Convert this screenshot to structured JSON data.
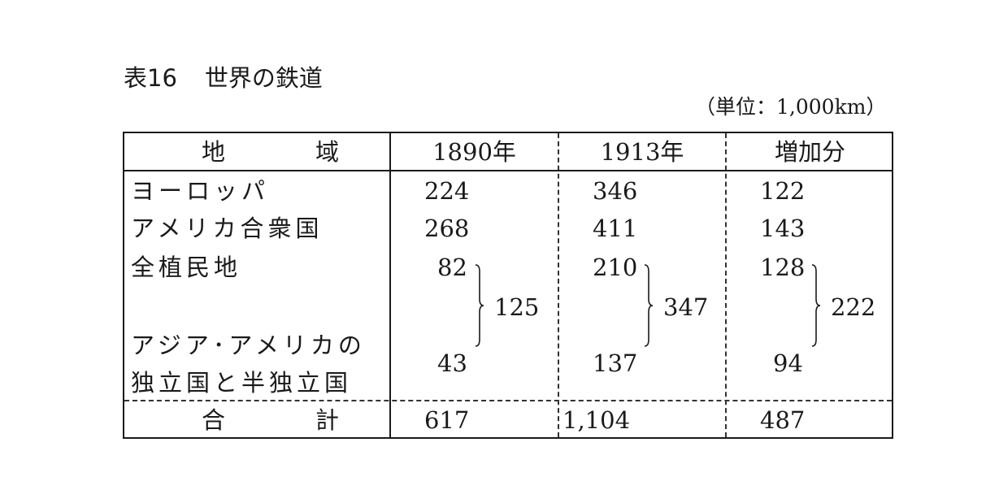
{
  "title": {
    "number": "表16",
    "text": "世界の鉄道"
  },
  "unit": "（単位：1,000km）",
  "header": {
    "region_left": "地",
    "region_right": "域",
    "col1": "1890年",
    "col2": "1913年",
    "col3": "増加分"
  },
  "rows": {
    "europe": {
      "label": "ヨーロッパ",
      "v1890": "224",
      "v1913": "346",
      "diff": "122"
    },
    "usa": {
      "label": "アメリカ合衆国",
      "v1890": "268",
      "v1913": "411",
      "diff": "143"
    },
    "colonies": {
      "label": "全植民地",
      "v1890": "82",
      "v1913": "210",
      "diff": "128"
    },
    "asia_america": {
      "label_line1": "アジア･アメリカの",
      "label_line2": "独立国と半独立国",
      "v1890": "43",
      "v1913": "137",
      "diff": "94"
    }
  },
  "subtotals": {
    "v1890": "125",
    "v1913": "347",
    "diff": "222"
  },
  "total": {
    "label_left": "合",
    "label_right": "計",
    "v1890": "617",
    "v1913": "1,104",
    "diff": "487"
  }
}
